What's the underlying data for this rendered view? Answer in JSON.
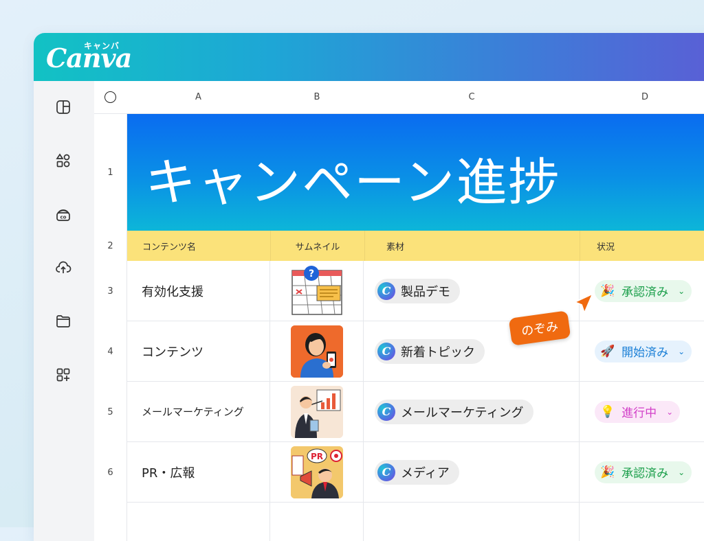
{
  "app": {
    "logo_text": "Canva",
    "logo_kana": "キャンバ"
  },
  "sidebar": {
    "items": [
      {
        "icon": "layout-icon"
      },
      {
        "icon": "elements-icon"
      },
      {
        "icon": "brand-icon"
      },
      {
        "icon": "upload-cloud-icon"
      },
      {
        "icon": "folder-icon"
      },
      {
        "icon": "apps-icon"
      }
    ]
  },
  "columns": [
    "A",
    "B",
    "C",
    "D"
  ],
  "rows": [
    "1",
    "2",
    "3",
    "4",
    "5",
    "6"
  ],
  "banner": {
    "title": "キャンペーン進捗"
  },
  "table_header": {
    "content_name": "コンテンツ名",
    "thumbnail": "サムネイル",
    "material": "素材",
    "status": "状況"
  },
  "records": [
    {
      "name": "有効化支援",
      "material": "製品デモ",
      "status": "承認済み",
      "status_emoji": "🎉",
      "status_color": "#1a9e4a",
      "status_bg": "#e8f8ec"
    },
    {
      "name": "コンテンツ",
      "material": "新着トピック",
      "status": "開始済み",
      "status_emoji": "🚀",
      "status_color": "#1a7fd6",
      "status_bg": "#e6f2fd"
    },
    {
      "name": "メールマーケティング",
      "material": "メールマーケティング",
      "status": "進行中",
      "status_emoji": "💡",
      "status_color": "#d23fc8",
      "status_bg": "#fbe8f8"
    },
    {
      "name": "PR・広報",
      "material": "メディア",
      "status": "承認済み",
      "status_emoji": "🎉",
      "status_color": "#1a9e4a",
      "status_bg": "#e8f8ec"
    }
  ],
  "collaborator": {
    "name": "のぞみ",
    "color": "#f06a10"
  },
  "chip_logo_letter": "C"
}
